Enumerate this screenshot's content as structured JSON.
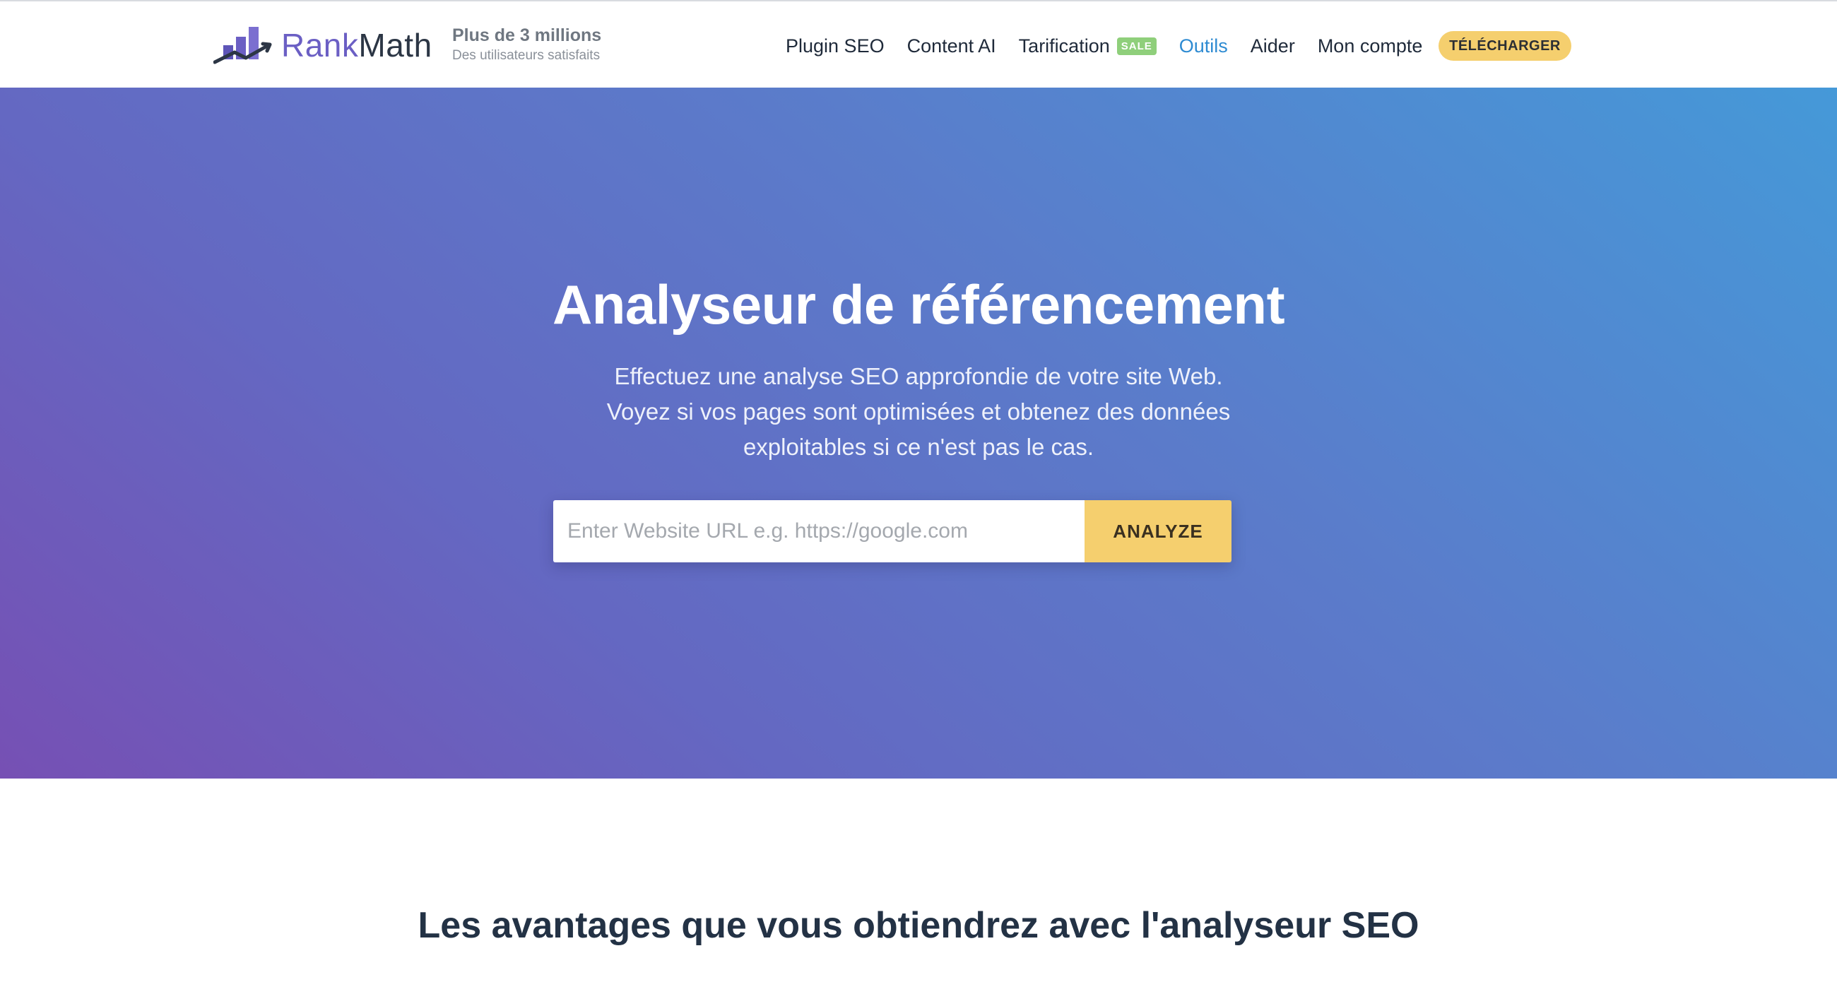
{
  "brand": {
    "name_part1": "Rank",
    "name_part2": "Math",
    "tagline_main": "Plus de 3 millions",
    "tagline_sub": "Des utilisateurs satisfaits",
    "logo_icon": "rankmath-bar-chart-logo-icon",
    "colors": {
      "rank": "#6b5fc4",
      "math": "#2c3645"
    }
  },
  "nav": {
    "items": [
      {
        "label": "Plugin SEO"
      },
      {
        "label": "Content AI"
      },
      {
        "label": "Tarification",
        "badge": "SALE"
      },
      {
        "label": "Outils",
        "active": true
      },
      {
        "label": "Aider"
      },
      {
        "label": "Mon compte"
      }
    ],
    "download_label": "TÉLÉCHARGER",
    "active_color": "#2e8bd2",
    "badge_color": "#8fcf7b",
    "download_color": "#f5cf6e"
  },
  "hero": {
    "title": "Analyseur de référencement",
    "desc_line1": "Effectuez une analyse SEO approfondie de votre site Web.",
    "desc_line2": "Voyez si vos pages sont optimisées et obtenez des données",
    "desc_line3": "exploitables si ce n'est pas le cas.",
    "input_placeholder": "Enter Website URL e.g. https://google.com",
    "input_value": "",
    "button_label": "ANALYZE",
    "gradient_colors": [
      "#7650b4",
      "#6468c2",
      "#5a7dcb",
      "#4599d8"
    ],
    "button_color": "#f5cf6e"
  },
  "benefits": {
    "title": "Les avantages que vous obtiendrez avec l'analyseur SEO"
  }
}
